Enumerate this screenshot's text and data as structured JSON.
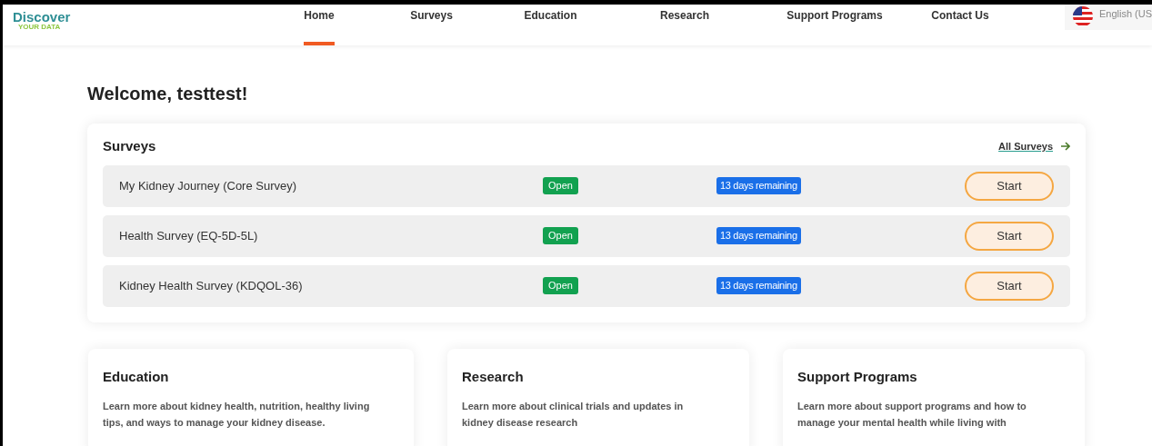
{
  "header": {
    "logo": {
      "name": "Discover",
      "tagline": "YOUR DATA"
    },
    "nav": [
      {
        "label": "Home",
        "selected": true
      },
      {
        "label": "Surveys",
        "selected": false
      },
      {
        "label": "Education",
        "selected": false
      },
      {
        "label": "Research",
        "selected": false
      },
      {
        "label": "Support Programs",
        "selected": false
      },
      {
        "label": "Contact Us",
        "selected": false
      }
    ],
    "language": "English (US"
  },
  "welcome": "Welcome, testtest!",
  "surveys": {
    "title": "Surveys",
    "all_link": "All Surveys",
    "rows": [
      {
        "name": "My Kidney Journey (Core Survey)",
        "status": "Open",
        "remaining": "13 days remaining",
        "action": "Start"
      },
      {
        "name": "Health Survey (EQ-5D-5L)",
        "status": "Open",
        "remaining": "13 days remaining",
        "action": "Start"
      },
      {
        "name": "Kidney Health Survey (KDQOL-36)",
        "status": "Open",
        "remaining": "13 days remaining",
        "action": "Start"
      }
    ]
  },
  "cards": [
    {
      "title": "Education",
      "text": "Learn more about kidney health, nutrition, healthy living tips, and ways to manage your kidney disease."
    },
    {
      "title": "Research",
      "text": "Learn more about clinical trials and updates in kidney disease research"
    },
    {
      "title": "Support Programs",
      "text": "Learn more about support programs and how to manage your mental health while living with"
    }
  ]
}
